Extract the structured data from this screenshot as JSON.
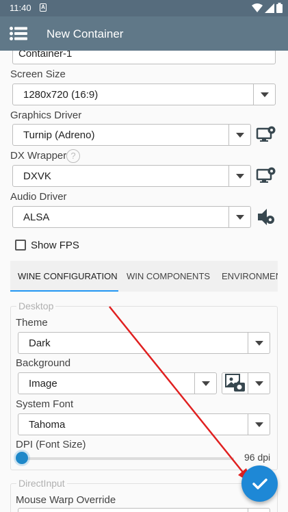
{
  "status_bar": {
    "time": "11:40",
    "notification_icon": "A"
  },
  "app_bar": {
    "title": "New Container",
    "menu_icon": "hamburger-menu-icon"
  },
  "form": {
    "name_value": "Container-1",
    "screen_size": {
      "label": "Screen Size",
      "value": "1280x720 (16:9)"
    },
    "graphics_driver": {
      "label": "Graphics Driver",
      "value": "Turnip (Adreno)"
    },
    "dx_wrapper": {
      "label": "DX Wrapper",
      "help": "?",
      "value": "DXVK"
    },
    "audio_driver": {
      "label": "Audio Driver",
      "value": "ALSA"
    },
    "show_fps": {
      "label": "Show FPS",
      "checked": false
    }
  },
  "tabs": [
    {
      "label": "WINE CONFIGURATION",
      "active": true
    },
    {
      "label": "WIN COMPONENTS",
      "active": false
    },
    {
      "label": "ENVIRONMEN",
      "active": false
    }
  ],
  "desktop": {
    "title": "Desktop",
    "theme": {
      "label": "Theme",
      "value": "Dark"
    },
    "background": {
      "label": "Background",
      "value": "Image"
    },
    "system_font": {
      "label": "System Font",
      "value": "Tahoma"
    },
    "dpi": {
      "label": "DPI (Font Size)",
      "value_text": "96 dpi",
      "level": 0.0
    }
  },
  "directinput": {
    "title": "DirectInput",
    "mouse_warp": {
      "label": "Mouse Warp Override"
    }
  },
  "fab": {
    "icon": "checkmark-icon"
  },
  "colors": {
    "status_bar": "#566c7d",
    "app_bar": "#607888",
    "accent": "#1e88d6",
    "annotation_arrow": "#e02020"
  }
}
